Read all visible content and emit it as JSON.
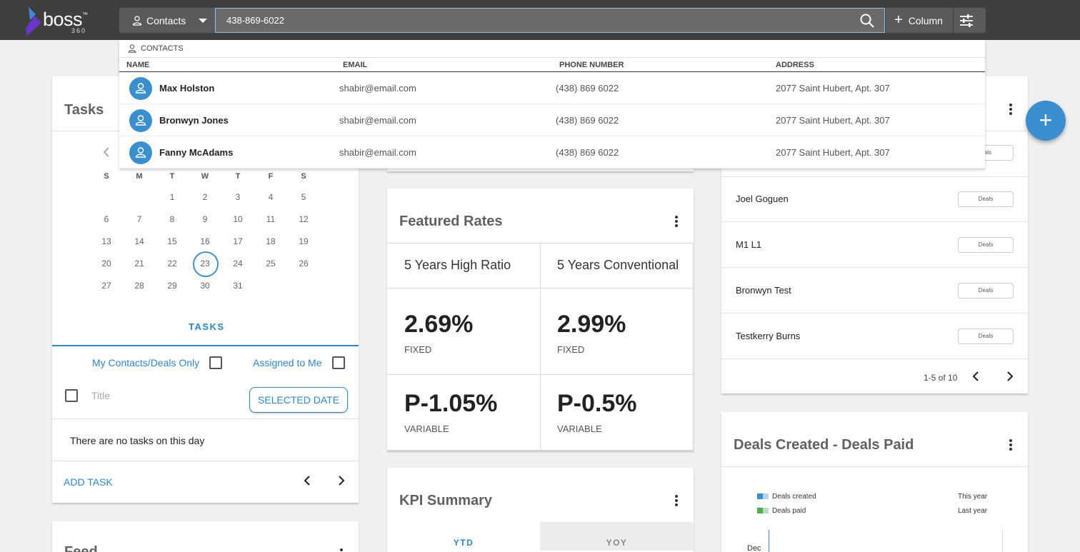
{
  "brand": {
    "name": "boss",
    "tm": "™",
    "sub": "360"
  },
  "search": {
    "scope_label": "Contacts",
    "query": "438-869-6022",
    "column_label": "Column"
  },
  "dropdown": {
    "section_label": "CONTACTS",
    "columns": [
      "NAME",
      "EMAIL",
      "PHONE NUMBER",
      "ADDRESS"
    ],
    "rows": [
      {
        "name": "Max Holston",
        "email": "shabir@email.com",
        "phone": "(438) 869 6022",
        "address": "2077 Saint Hubert, Apt. 307"
      },
      {
        "name": "Bronwyn Jones",
        "email": "shabir@email.com",
        "phone": "(438) 869 6022",
        "address": "2077 Saint Hubert, Apt. 307"
      },
      {
        "name": "Fanny McAdams",
        "email": "shabir@email.com",
        "phone": "(438) 869 6022",
        "address": "2077 Saint Hubert, Apt. 307"
      }
    ]
  },
  "tasks": {
    "title": "Tasks",
    "weekdays": [
      "S",
      "M",
      "T",
      "W",
      "T",
      "F",
      "S"
    ],
    "weeks": [
      [
        "",
        "",
        "1",
        "2",
        "3",
        "4",
        "5"
      ],
      [
        "6",
        "7",
        "8",
        "9",
        "10",
        "11",
        "12"
      ],
      [
        "13",
        "14",
        "15",
        "16",
        "17",
        "18",
        "19"
      ],
      [
        "20",
        "21",
        "22",
        "23",
        "24",
        "25",
        "26"
      ],
      [
        "27",
        "28",
        "29",
        "30",
        "31",
        "",
        ""
      ]
    ],
    "selected_day": "23",
    "tab_label": "TASKS",
    "my_contacts_label": "My Contacts/Deals Only",
    "assigned_label": "Assigned to Me",
    "title_placeholder": "Title",
    "selected_date_label": "SELECTED DATE",
    "empty_message": "There are no tasks on this day",
    "add_task_label": "ADD TASK"
  },
  "feed": {
    "title": "Feed"
  },
  "rates": {
    "title": "Featured Rates",
    "columns": [
      {
        "name": "5 Years High Ratio",
        "fixed": "2.69%",
        "fixed_label": "FIXED",
        "variable": "P-1.05%",
        "variable_label": "VARIABLE"
      },
      {
        "name": "5 Years Conventional",
        "fixed": "2.99%",
        "fixed_label": "FIXED",
        "variable": "P-0.5%",
        "variable_label": "VARIABLE"
      }
    ]
  },
  "kpi": {
    "title": "KPI Summary",
    "tabs": [
      "YTD",
      "YOY"
    ]
  },
  "deals_list": {
    "rows": [
      {
        "name": "Joel Goguen",
        "button": "Deals"
      },
      {
        "name": "M1 L1",
        "button": "Deals"
      },
      {
        "name": "Bronwyn Test",
        "button": "Deals"
      },
      {
        "name": "Testkerry Burns",
        "button": "Deals"
      }
    ],
    "partial_button": "als",
    "pagination": "1-5 of 10"
  },
  "deals_chart": {
    "title": "Deals Created - Deals Paid",
    "legend": [
      {
        "label": "Deals created",
        "right": "This year",
        "colors": [
          "#3b8fcf",
          "#b8d4ec"
        ]
      },
      {
        "label": "Deals paid",
        "right": "Last year",
        "colors": [
          "#4cae4c",
          "#b9ddb9"
        ]
      }
    ],
    "first_month": "Dec"
  },
  "colors": {
    "accent": "#2f86c8",
    "topbar": "#3f3f3f",
    "fab": "#3b8fcf"
  }
}
